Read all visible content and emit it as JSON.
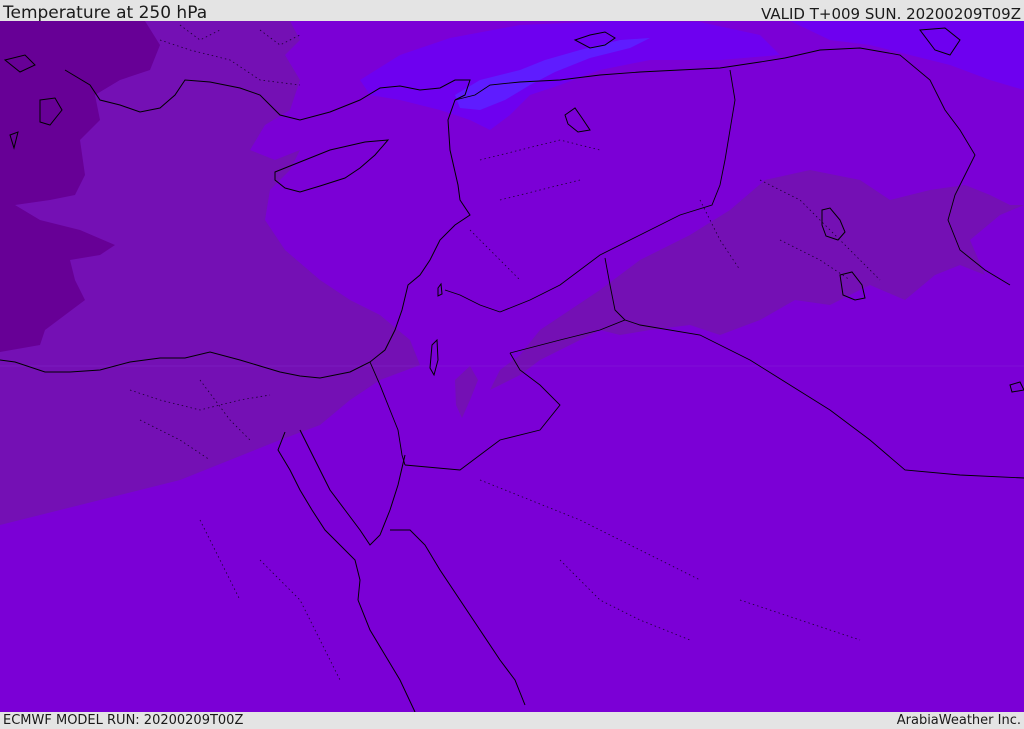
{
  "header": {
    "title": "Temperature at 250 hPa",
    "valid_time": "VALID T+009 SUN. 20200209T09Z"
  },
  "footer": {
    "model_run": "ECMWF MODEL RUN: 20200209T00Z",
    "credit": "ArabiaWeather Inc."
  },
  "map": {
    "field": "temperature",
    "level": "250 hPa",
    "colors": {
      "base": "#7b00d6",
      "band_colder": "#7410b4",
      "band_coldest": "#670096",
      "band_warmer": "#6e00f0",
      "band_warmest": "#5f1cff",
      "coastline": "#000000",
      "border": "#000000",
      "background_frame": "#e4e4e4"
    }
  }
}
